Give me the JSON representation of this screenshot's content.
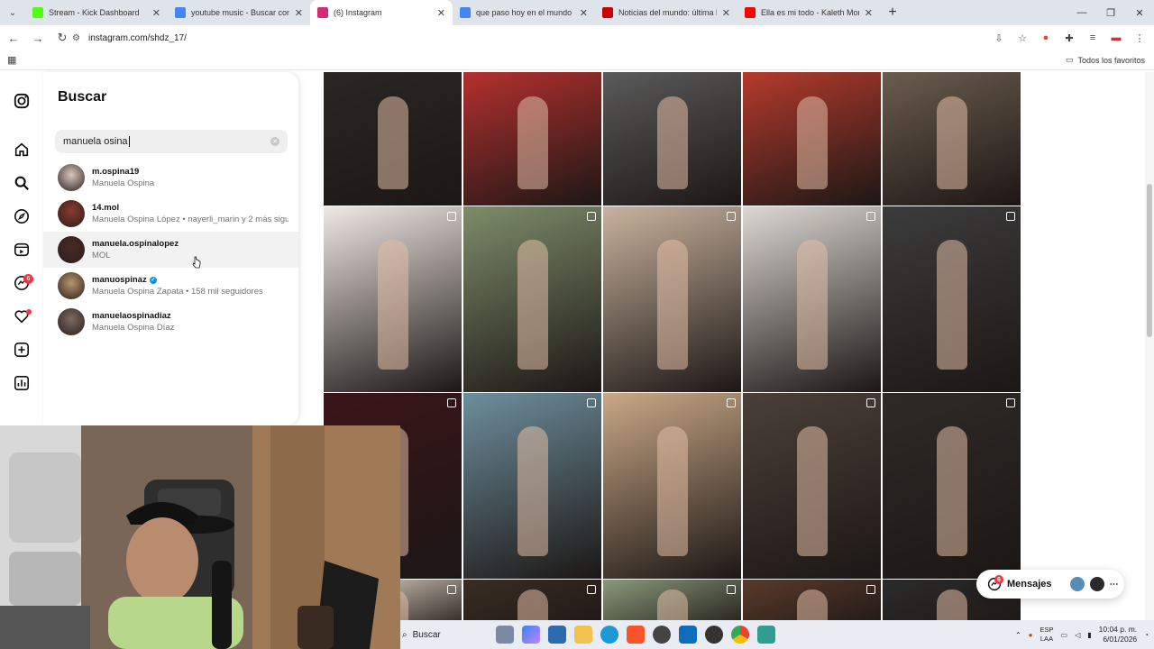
{
  "browser": {
    "tabs": [
      {
        "title": "Stream - Kick Dashboard",
        "color": "#53fc18",
        "active": false
      },
      {
        "title": "youtube music - Buscar con Go",
        "color": "#4285f4",
        "active": false
      },
      {
        "title": "(6) Instagram",
        "color": "#d62976",
        "active": true
      },
      {
        "title": "que paso hoy en el mundo - Bu",
        "color": "#4285f4",
        "active": false
      },
      {
        "title": "Noticias del mundo: última hor",
        "color": "#cc0000",
        "active": false
      },
      {
        "title": "Ella es mi todo - Kaleth Morale",
        "color": "#ff0000",
        "active": false
      }
    ],
    "url": "instagram.com/shdz_17/",
    "bookmarks_folder": "Todos los favoritos"
  },
  "instagram": {
    "nav_icons": [
      "instagram-logo",
      "home",
      "search",
      "explore",
      "reels",
      "messages",
      "notifications",
      "create",
      "dashboard",
      "profile"
    ],
    "messages_badge": "6",
    "search": {
      "title": "Buscar",
      "query": "manuela osina",
      "results": [
        {
          "username": "m.ospina19",
          "detail": "Manuela Ospina",
          "verified": false,
          "color": "#d9c8bf"
        },
        {
          "username": "14.mol",
          "detail": "Manuela Ospina López • nayerli_marin y 2 más siguen",
          "verified": false,
          "color": "#8a3a2e"
        },
        {
          "username": "manuela.ospinalopez",
          "detail": "MOL",
          "verified": false,
          "color": "#4a2a26"
        },
        {
          "username": "manuospinaz",
          "detail": "Manuela Ospina Zapata • 158 mil seguidores",
          "verified": true,
          "color": "#b8956f"
        },
        {
          "username": "manuelaospinadiaz",
          "detail": "Manuela Ospina Díaz",
          "verified": false,
          "color": "#7d6a62"
        }
      ]
    },
    "grid_colors": [
      [
        "#2b2624",
        "#b4302e",
        "#5a5a5a",
        "#b53a2c",
        "#6b5c4e"
      ],
      [
        "#efe8e4",
        "#7d8c6a",
        "#c9b39e",
        "#ddd8d2",
        "#3c3c3c"
      ],
      [
        "#3a1518",
        "#6d8e9c",
        "#c9a886",
        "#4a4038",
        "#2e2a26"
      ],
      [
        "#e8dccb",
        "#3a2d22",
        "#8a9a7a",
        "#5a3a2a",
        "#2b2b2b"
      ]
    ],
    "messages_label": "Mensajes",
    "messages_count": "6"
  },
  "taskbar": {
    "search_label": "Buscar",
    "lang_line1": "ESP",
    "lang_line2": "LAA",
    "time": "10:04 p. m.",
    "date": "6/01/2026"
  }
}
